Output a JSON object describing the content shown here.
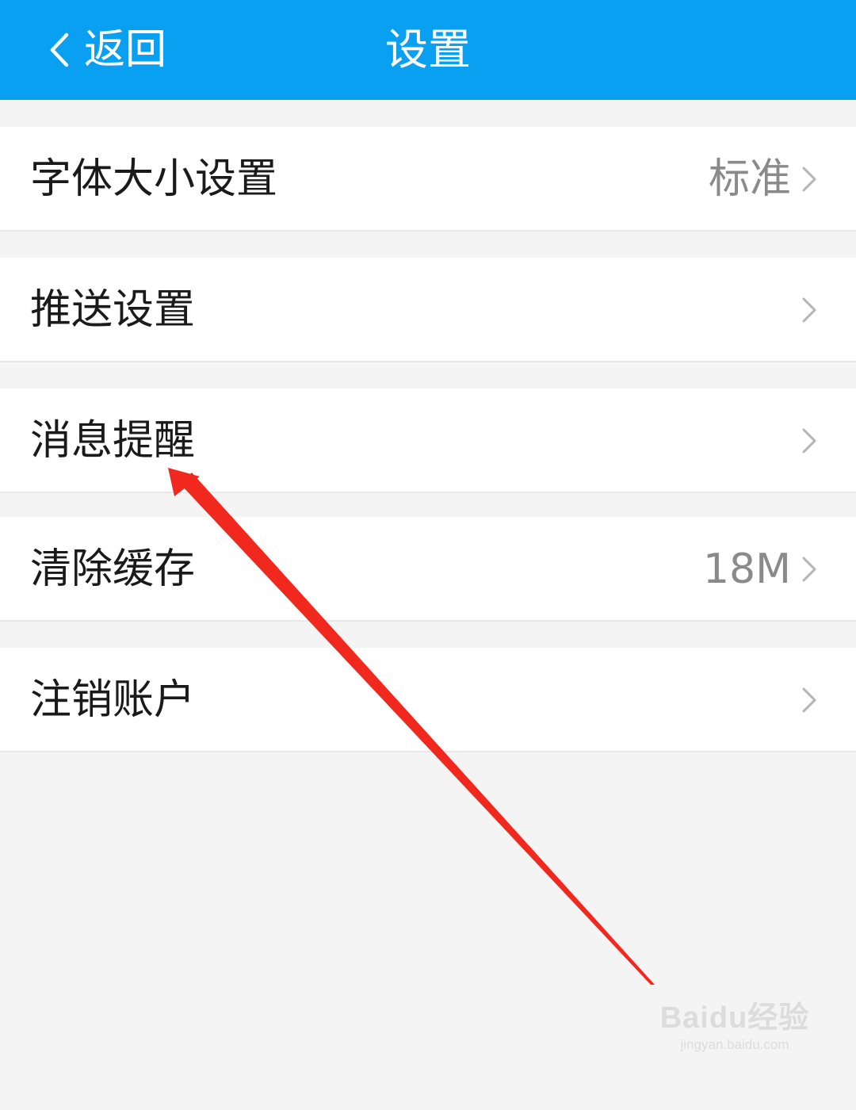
{
  "header": {
    "back_label": "返回",
    "title": "设置",
    "background_color": "#0aa0f2"
  },
  "settings": [
    {
      "label": "字体大小设置",
      "value": "标准"
    },
    {
      "label": "推送设置",
      "value": ""
    },
    {
      "label": "消息提醒",
      "value": ""
    },
    {
      "label": "清除缓存",
      "value": "18M"
    },
    {
      "label": "注销账户",
      "value": ""
    }
  ],
  "icons": {
    "back": "chevron-left-icon",
    "row_arrow": "chevron-right-icon"
  },
  "annotation": {
    "arrow_color": "#f0281e",
    "points_to": "消息提醒"
  },
  "watermark": {
    "logo": "Baidu经验",
    "url": "jingyan.baidu.com"
  }
}
